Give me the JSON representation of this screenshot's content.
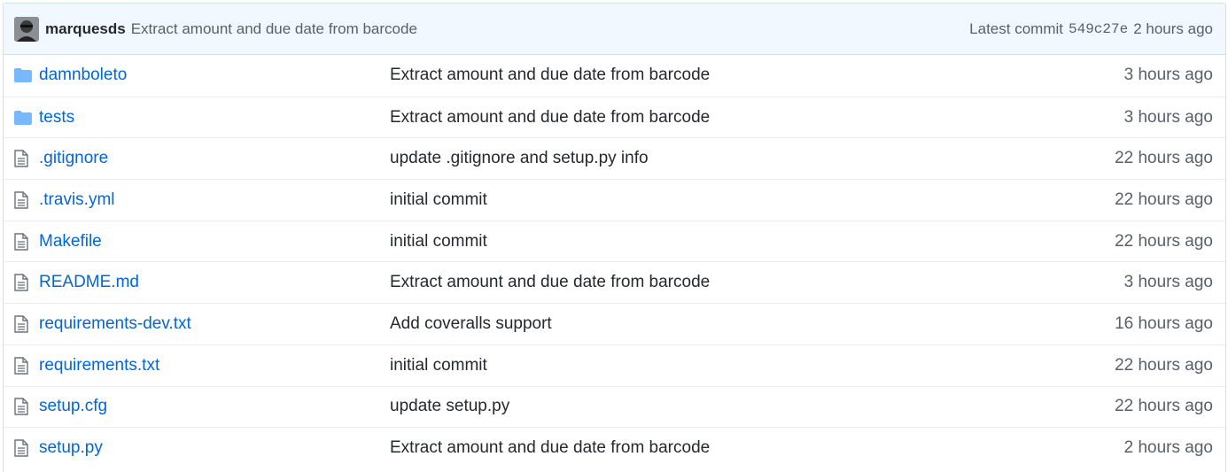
{
  "commit_bar": {
    "author": "marquesds",
    "message": "Extract amount and due date from barcode",
    "latest_label": "Latest commit",
    "sha": "549c27e",
    "age": "2 hours ago"
  },
  "files": [
    {
      "name": "damnboleto",
      "icon": "folder-icon",
      "commit": "Extract amount and due date from barcode",
      "age": "3 hours ago"
    },
    {
      "name": "tests",
      "icon": "folder-icon",
      "commit": "Extract amount and due date from barcode",
      "age": "3 hours ago"
    },
    {
      "name": ".gitignore",
      "icon": "file-icon",
      "commit": "update .gitignore and setup.py info",
      "age": "22 hours ago"
    },
    {
      "name": ".travis.yml",
      "icon": "file-icon",
      "commit": "initial commit",
      "age": "22 hours ago"
    },
    {
      "name": "Makefile",
      "icon": "file-icon",
      "commit": "initial commit",
      "age": "22 hours ago"
    },
    {
      "name": "README.md",
      "icon": "file-icon",
      "commit": "Extract amount and due date from barcode",
      "age": "3 hours ago"
    },
    {
      "name": "requirements-dev.txt",
      "icon": "file-icon",
      "commit": "Add coveralls support",
      "age": "16 hours ago"
    },
    {
      "name": "requirements.txt",
      "icon": "file-icon",
      "commit": "initial commit",
      "age": "22 hours ago"
    },
    {
      "name": "setup.cfg",
      "icon": "file-icon",
      "commit": "update setup.py",
      "age": "22 hours ago"
    },
    {
      "name": "setup.py",
      "icon": "file-icon",
      "commit": "Extract amount and due date from barcode",
      "age": "2 hours ago"
    }
  ],
  "colors": {
    "link": "#0366d6",
    "folder_icon": "#79b8ff",
    "header_bg": "#f1f8ff",
    "border": "#c8e1ff"
  }
}
